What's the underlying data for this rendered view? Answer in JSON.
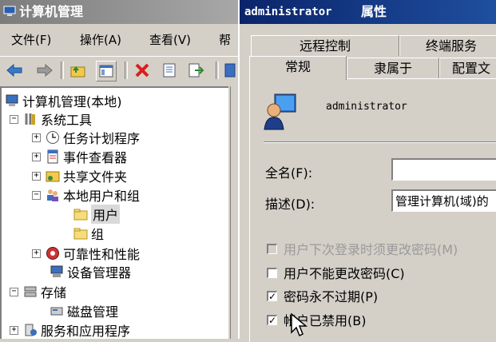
{
  "main_window": {
    "title": "计算机管理",
    "menu": [
      "文件(F)",
      "操作(A)",
      "查看(V)",
      "帮"
    ]
  },
  "tree": {
    "root": "计算机管理(本地)",
    "system_tools": "系统工具",
    "task_scheduler": "任务计划程序",
    "event_viewer": "事件查看器",
    "shared_folders": "共享文件夹",
    "local_users_groups": "本地用户和组",
    "users": "用户",
    "groups": "组",
    "reliability": "可靠性和性能",
    "device_manager": "设备管理器",
    "storage": "存储",
    "disk_management": "磁盘管理",
    "services_apps": "服务和应用程序"
  },
  "dialog": {
    "title_user": "administrator",
    "title_suffix": "属性",
    "tabs_row1": [
      "远程控制",
      "终端服务"
    ],
    "tabs_row2": [
      "常规",
      "隶属于",
      "配置文"
    ],
    "active_tab": "常规",
    "username": "administrator",
    "full_name_label": "全名(F):",
    "full_name_value": "",
    "description_label": "描述(D):",
    "description_value": "管理计算机(域)的",
    "checkboxes": [
      {
        "label": "用户下次登录时须更改密码(M)",
        "checked": false,
        "enabled": false
      },
      {
        "label": "用户不能更改密码(C)",
        "checked": false,
        "enabled": true
      },
      {
        "label": "密码永不过期(P)",
        "checked": true,
        "enabled": true
      },
      {
        "label": "帐户已禁用(B)",
        "checked": true,
        "enabled": true
      }
    ]
  },
  "colors": {
    "dialog_title": "#0a246a",
    "main_title": "#7c7c7c",
    "face": "#d4d0c8"
  }
}
